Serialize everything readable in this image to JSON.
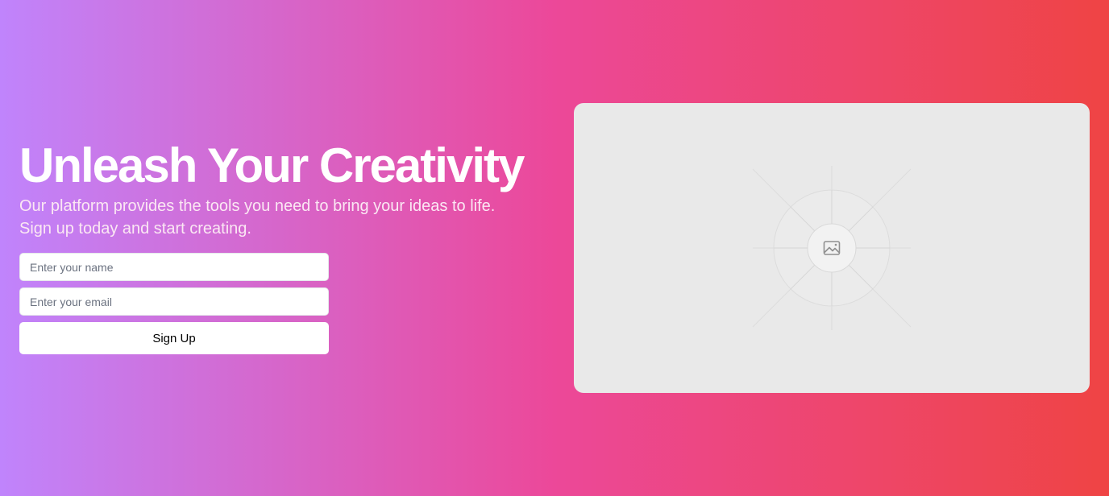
{
  "hero": {
    "headline": "Unleash Your Creativity",
    "subtext": "Our platform provides the tools you need to bring your ideas to life. Sign up today and start creating.",
    "form": {
      "name_placeholder": "Enter your name",
      "email_placeholder": "Enter your email",
      "submit_label": "Sign Up"
    },
    "image": {
      "icon": "image-icon"
    }
  },
  "colors": {
    "gradient_start": "#c084fc",
    "gradient_mid": "#ec4899",
    "gradient_end": "#ef4444",
    "placeholder_bg": "#e9e9e9"
  }
}
